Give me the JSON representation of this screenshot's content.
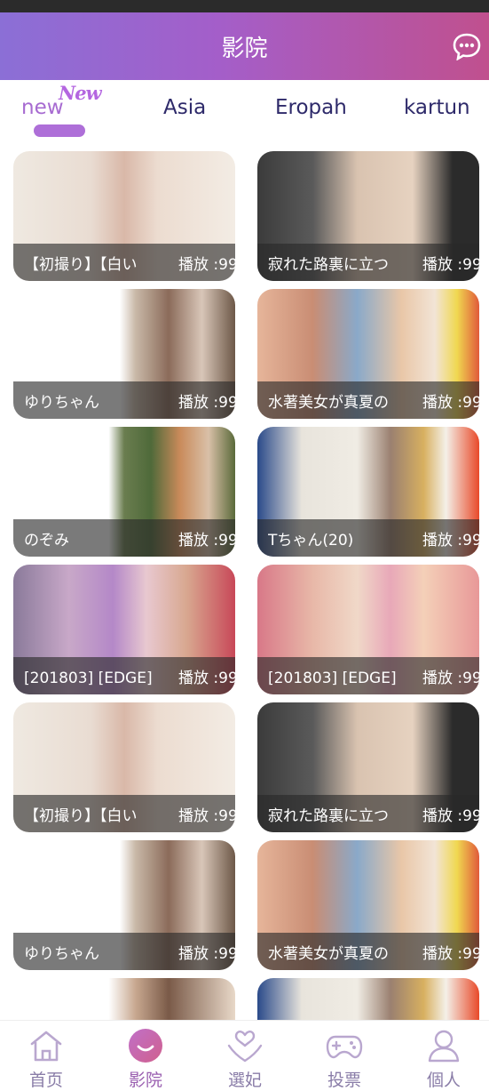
{
  "header": {
    "title": "影院",
    "chat_icon": "chat-bubble-icon"
  },
  "tabs": [
    {
      "label": "new",
      "active": true
    },
    {
      "label": "Asia",
      "active": false
    },
    {
      "label": "Eropah",
      "active": false
    },
    {
      "label": "kartun",
      "active": false
    }
  ],
  "new_badge": "New",
  "videos": [
    {
      "title": "【初撮り】【白い",
      "plays": "播放 :99"
    },
    {
      "title": "寂れた路裏に立つ",
      "plays": "播放 :99"
    },
    {
      "title": "ゆりちゃん",
      "plays": "播放 :99"
    },
    {
      "title": "水著美女が真夏の",
      "plays": "播放 :99"
    },
    {
      "title": "のぞみ",
      "plays": "播放 :99"
    },
    {
      "title": "Tちゃん(20)",
      "plays": "播放 :99"
    },
    {
      "title": "[201803] [EDGE]",
      "plays": "播放 :99"
    },
    {
      "title": "[201803] [EDGE]",
      "plays": "播放 :99"
    },
    {
      "title": "【初撮り】【白い",
      "plays": "播放 :99"
    },
    {
      "title": "寂れた路裏に立つ",
      "plays": "播放 :99"
    },
    {
      "title": "ゆりちゃん",
      "plays": "播放 :99"
    },
    {
      "title": "水著美女が真夏の",
      "plays": "播放 :99"
    },
    {
      "title": "",
      "plays": ""
    },
    {
      "title": "",
      "plays": ""
    }
  ],
  "bottom_nav": [
    {
      "label": "首页",
      "icon": "home-icon",
      "active": false
    },
    {
      "label": "影院",
      "icon": "smile-icon",
      "active": true
    },
    {
      "label": "選妃",
      "icon": "heart-hands-icon",
      "active": false
    },
    {
      "label": "投票",
      "icon": "gamepad-icon",
      "active": false
    },
    {
      "label": "個人",
      "icon": "person-icon",
      "active": false
    }
  ],
  "colors": {
    "header_start": "#8b6fd6",
    "header_end": "#c0508e",
    "accent": "#ae6fd8",
    "tab_text": "#2e2a6a"
  }
}
